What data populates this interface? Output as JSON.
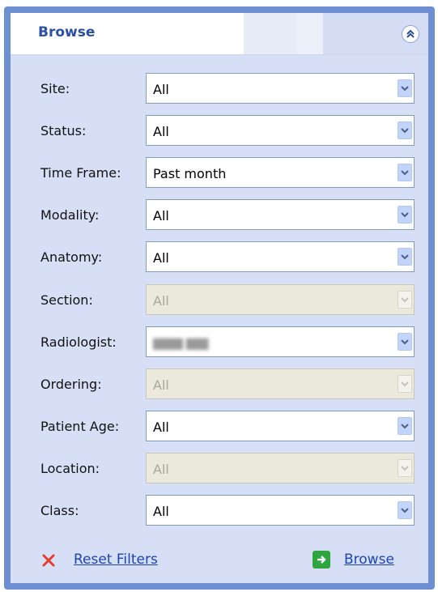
{
  "panel": {
    "title": "Browse",
    "collapse_icon": "double-chevron-up-icon"
  },
  "filters": [
    {
      "label": "Site:",
      "value": "All",
      "enabled": true
    },
    {
      "label": "Status:",
      "value": "All",
      "enabled": true
    },
    {
      "label": "Time Frame:",
      "value": "Past month",
      "enabled": true
    },
    {
      "label": "Modality:",
      "value": "All",
      "enabled": true
    },
    {
      "label": "Anatomy:",
      "value": "All",
      "enabled": true
    },
    {
      "label": "Section:",
      "value": "All",
      "enabled": false
    },
    {
      "label": "Radiologist:",
      "value": "",
      "enabled": true,
      "redacted": true
    },
    {
      "label": "Ordering:",
      "value": "All",
      "enabled": false
    },
    {
      "label": "Patient Age:",
      "value": "All",
      "enabled": true
    },
    {
      "label": "Location:",
      "value": "All",
      "enabled": false
    },
    {
      "label": "Class:",
      "value": "All",
      "enabled": true
    }
  ],
  "footer": {
    "reset_label": "Reset Filters",
    "reset_icon": "x-icon",
    "browse_label": "Browse",
    "browse_icon": "arrow-right-icon"
  },
  "colors": {
    "panel_border": "#6f8fd3",
    "panel_body": "#d6dff5",
    "title": "#2b4fa4",
    "link": "#1d44b3",
    "reset_icon": "#e0402b",
    "browse_icon_bg": "#2fa542"
  }
}
